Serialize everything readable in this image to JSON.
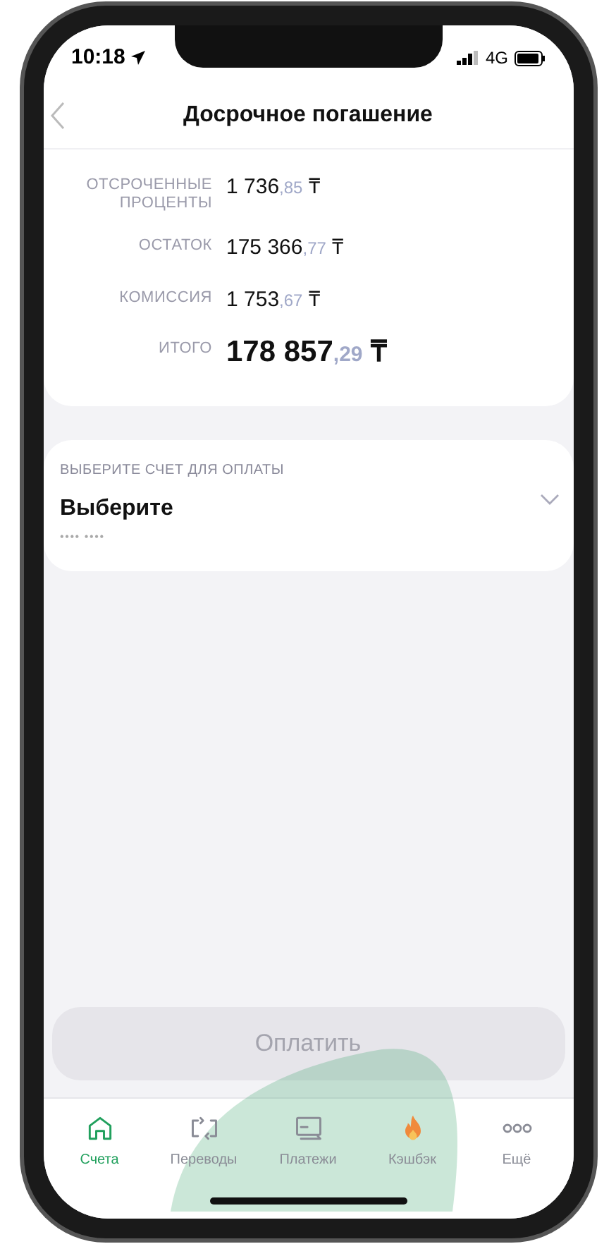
{
  "status_bar": {
    "time": "10:18",
    "network": "4G"
  },
  "header": {
    "title": "Досрочное погашение"
  },
  "summary": [
    {
      "label": "ОТСРОЧЕННЫЕ ПРОЦЕНТЫ",
      "main": "1 736",
      "fraction": ",85",
      "currency": "₸",
      "kind": "regular"
    },
    {
      "label": "ОСТАТОК",
      "main": "175 366",
      "fraction": ",77",
      "currency": "₸",
      "kind": "regular"
    },
    {
      "label": "КОМИССИЯ",
      "main": "1 753",
      "fraction": ",67",
      "currency": "₸",
      "kind": "regular"
    },
    {
      "label": "ИТОГО",
      "main": "178 857",
      "fraction": ",29",
      "currency": "₸",
      "kind": "total"
    }
  ],
  "account_select": {
    "label": "ВЫБЕРИТЕ СЧЕТ ДЛЯ ОПЛАТЫ",
    "value": "Выберите",
    "mask": "•••• ••••",
    "expanded": false
  },
  "pay_button": {
    "label": "Оплатить",
    "disabled": true
  },
  "tab_bar": [
    {
      "label": "Счета",
      "selected": true
    },
    {
      "label": "Переводы",
      "selected": false
    },
    {
      "label": "Платежи",
      "selected": false
    },
    {
      "label": "Кэшбэк",
      "selected": false
    },
    {
      "label": "Ещё",
      "selected": false
    }
  ]
}
